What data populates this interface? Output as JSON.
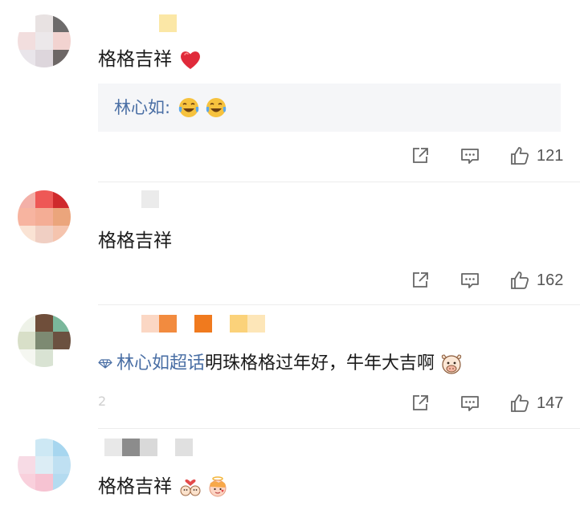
{
  "comments": [
    {
      "text": "格格吉祥",
      "emoji": "heart-icon",
      "reply": {
        "name": "林心如:",
        "emojis": [
          "tears-of-joy-icon",
          "tears-of-joy-icon"
        ]
      },
      "likes": "121"
    },
    {
      "text": "格格吉祥",
      "likes": "162"
    },
    {
      "topic": "林心如超话",
      "text": "明珠格格过年好，牛年大吉啊",
      "emoji": "ox-face-icon",
      "likes": "147"
    },
    {
      "text": "格格吉祥",
      "emojis": [
        "couple-heart-icon",
        "cherub-icon"
      ]
    }
  ],
  "icons": {
    "share": "share-icon",
    "reply": "comment-icon",
    "like": "thumbs-up-icon"
  },
  "colors": {
    "link": "#4a6fa5",
    "heart": "#e02a3a",
    "reply_bg": "#f5f6f8",
    "icon_gray": "#666666"
  }
}
